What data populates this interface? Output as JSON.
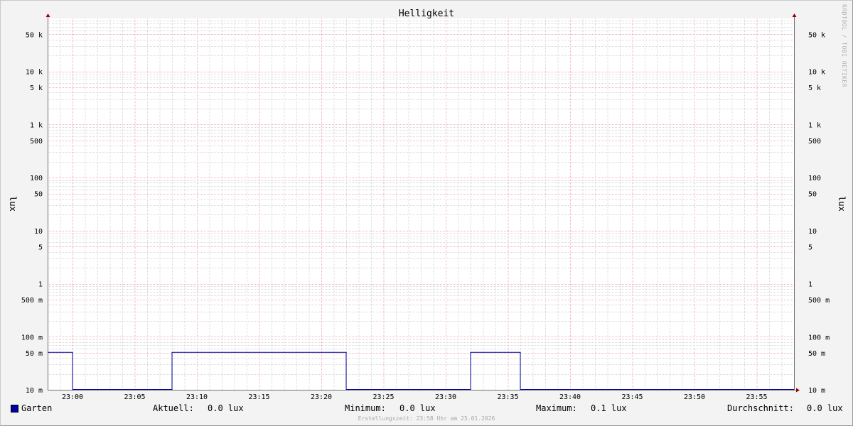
{
  "chart_data": {
    "type": "line",
    "title": "Helligkeit",
    "ylabel": "lux",
    "y_scale": "log",
    "ylim": [
      0.01,
      100000
    ],
    "xlim": [
      "22:58",
      "23:58"
    ],
    "grid": true,
    "y_tick_labels": [
      {
        "value": 50000,
        "label": "50 k"
      },
      {
        "value": 10000,
        "label": "10 k"
      },
      {
        "value": 5000,
        "label": "5 k"
      },
      {
        "value": 1000,
        "label": "1 k"
      },
      {
        "value": 500,
        "label": "500"
      },
      {
        "value": 100,
        "label": "100"
      },
      {
        "value": 50,
        "label": "50"
      },
      {
        "value": 10,
        "label": "10"
      },
      {
        "value": 5,
        "label": "5"
      },
      {
        "value": 1,
        "label": "1"
      },
      {
        "value": 0.5,
        "label": "500 m"
      },
      {
        "value": 0.1,
        "label": "100 m"
      },
      {
        "value": 0.05,
        "label": "50 m"
      },
      {
        "value": 0.01,
        "label": "10 m"
      }
    ],
    "x_tick_labels": [
      "23:00",
      "23:05",
      "23:10",
      "23:15",
      "23:20",
      "23:25",
      "23:30",
      "23:35",
      "23:40",
      "23:45",
      "23:50",
      "23:55"
    ],
    "series": [
      {
        "name": "Garten",
        "color": "#0000a0",
        "points": [
          [
            "22:58",
            0.05
          ],
          [
            "23:00",
            0.05
          ],
          [
            "23:00",
            0.01
          ],
          [
            "23:08",
            0.01
          ],
          [
            "23:08",
            0.05
          ],
          [
            "23:22",
            0.05
          ],
          [
            "23:22",
            0.01
          ],
          [
            "23:32",
            0.01
          ],
          [
            "23:32",
            0.05
          ],
          [
            "23:36",
            0.05
          ],
          [
            "23:36",
            0.01
          ],
          [
            "23:58",
            0.01
          ]
        ]
      }
    ]
  },
  "legend": {
    "series_name": "Garten",
    "current_label": "Aktuell:",
    "current_value": "0.0 lux",
    "min_label": "Minimum:",
    "min_value": "0.0 lux",
    "max_label": "Maximum:",
    "max_value": "0.1 lux",
    "avg_label": "Durchschnitt:",
    "avg_value": "0.0 lux"
  },
  "watermark": "RRDTOOL / TOBI OETIKER",
  "footer": "Erstellungszeit: 23:58 Uhr am 25.01.2026"
}
